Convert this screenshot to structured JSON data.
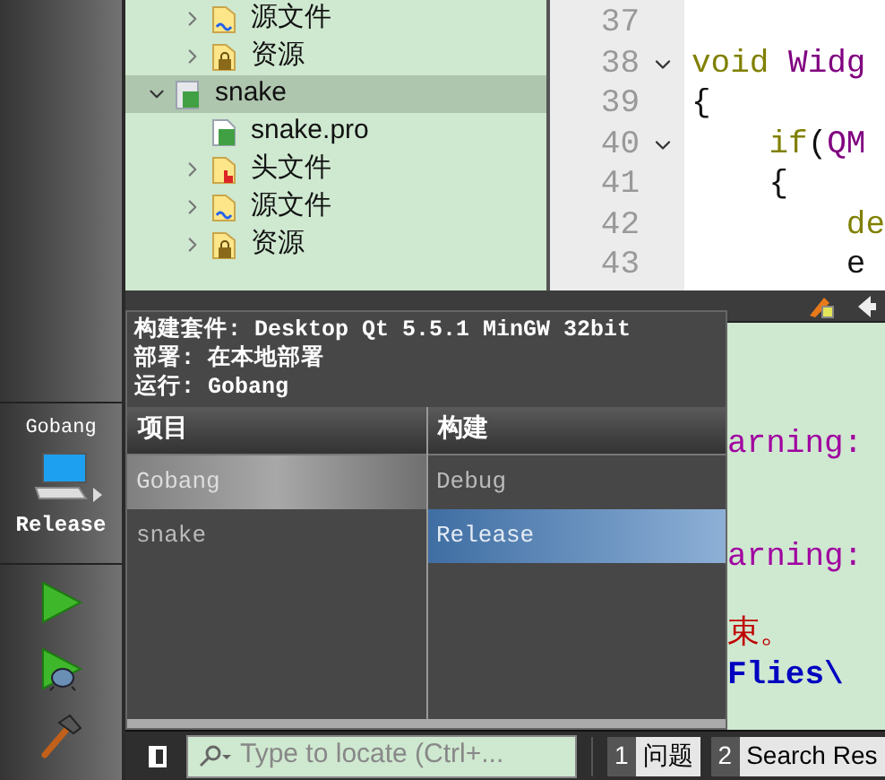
{
  "sidebar": {
    "kit": {
      "project": "Gobang",
      "build": "Release"
    },
    "actions": [
      {
        "kind": "run"
      },
      {
        "kind": "debug"
      },
      {
        "kind": "build"
      }
    ]
  },
  "project_tree": [
    {
      "kind": "partial",
      "children": [
        {
          "kind": "sources",
          "label": "源文件",
          "expanded": false
        },
        {
          "kind": "resources",
          "label": "资源",
          "expanded": false
        }
      ]
    },
    {
      "kind": "project",
      "label": "snake",
      "expanded": true,
      "selected": true,
      "children": [
        {
          "kind": "pro-file",
          "label": "snake.pro"
        },
        {
          "kind": "headers",
          "label": "头文件",
          "expanded": false
        },
        {
          "kind": "sources",
          "label": "源文件",
          "expanded": false
        },
        {
          "kind": "resources",
          "label": "资源",
          "expanded": false
        }
      ]
    }
  ],
  "editor": {
    "lines": [
      {
        "number": "37"
      },
      {
        "number": "38",
        "fold": true,
        "tokens": [
          {
            "kind": "keyword",
            "text": "void"
          },
          {
            "kind": "type",
            "text": " Widg"
          }
        ]
      },
      {
        "number": "39",
        "tokens": [
          {
            "kind": "plain",
            "text": "{"
          }
        ]
      },
      {
        "number": "40",
        "fold": true,
        "tokens": [
          {
            "kind": "keyword",
            "text": "    if"
          },
          {
            "kind": "plain",
            "text": "("
          },
          {
            "kind": "type",
            "text": "QM"
          }
        ]
      },
      {
        "number": "41",
        "tokens": [
          {
            "kind": "plain",
            "text": "    {"
          }
        ]
      },
      {
        "number": "42",
        "tokens": [
          {
            "kind": "keyword",
            "text": "        de"
          }
        ]
      },
      {
        "number": "43",
        "tokens": [
          {
            "kind": "plain",
            "text": "        e"
          }
        ]
      }
    ]
  },
  "output": {
    "lines": [
      {
        "kind": "warning",
        "text": "arning:"
      },
      {
        "kind": "warning",
        "text": "arning:"
      },
      {
        "kind": "error",
        "text": "束。"
      },
      {
        "kind": "path",
        "text": "Flies\\"
      }
    ]
  },
  "kit_popup": {
    "info": [
      "构建套件: Desktop Qt 5.5.1 MinGW 32bit",
      "部署: 在本地部署",
      "运行: Gobang"
    ],
    "columns": [
      {
        "title": "项目",
        "items": [
          {
            "label": "Gobang",
            "selected": true
          },
          {
            "label": "snake",
            "selected": false
          }
        ]
      },
      {
        "title": "构建",
        "items": [
          {
            "label": "Debug",
            "selected": false
          },
          {
            "label": "Release",
            "selected": true
          }
        ]
      }
    ]
  },
  "bottom_bar": {
    "search": {
      "placeholder": "Type to locate (Ctrl+..."
    },
    "tabs": [
      {
        "number": "1",
        "label": "问题"
      },
      {
        "number": "2",
        "label": "Search Res"
      }
    ]
  }
}
